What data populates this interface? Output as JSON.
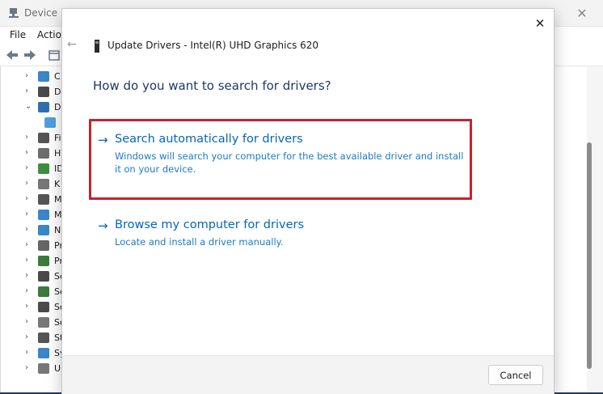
{
  "background_window": {
    "title": "Device M",
    "close_glyph": "✕",
    "menu": [
      "File",
      "Action"
    ],
    "tree_items": [
      {
        "arrow": "›",
        "label": "C",
        "icon": "computer-icon"
      },
      {
        "arrow": "›",
        "label": "D",
        "icon": "disk-drive-icon"
      },
      {
        "arrow": "⌄",
        "label": "D",
        "icon": "display-adapter-icon"
      },
      {
        "arrow": "",
        "label": "",
        "icon": "display-device-icon"
      },
      {
        "arrow": "›",
        "label": "Fi",
        "icon": "firmware-icon"
      },
      {
        "arrow": "›",
        "label": "H",
        "icon": "hid-icon"
      },
      {
        "arrow": "›",
        "label": "ID",
        "icon": "ide-icon"
      },
      {
        "arrow": "›",
        "label": "K",
        "icon": "keyboard-icon"
      },
      {
        "arrow": "›",
        "label": "M",
        "icon": "mouse-icon"
      },
      {
        "arrow": "›",
        "label": "M",
        "icon": "monitor-icon"
      },
      {
        "arrow": "›",
        "label": "N",
        "icon": "network-icon"
      },
      {
        "arrow": "›",
        "label": "Pr",
        "icon": "print-queue-icon"
      },
      {
        "arrow": "›",
        "label": "Pr",
        "icon": "processor-icon"
      },
      {
        "arrow": "›",
        "label": "Se",
        "icon": "security-device-icon"
      },
      {
        "arrow": "›",
        "label": "Se",
        "icon": "sensor-icon"
      },
      {
        "arrow": "›",
        "label": "So",
        "icon": "software-device-icon"
      },
      {
        "arrow": "›",
        "label": "So",
        "icon": "sound-icon"
      },
      {
        "arrow": "›",
        "label": "St",
        "icon": "storage-icon"
      },
      {
        "arrow": "›",
        "label": "Sy",
        "icon": "system-device-icon"
      },
      {
        "arrow": "›",
        "label": "U",
        "icon": "usb-icon"
      }
    ]
  },
  "dialog": {
    "close_glyph": "✕",
    "back_glyph": "←",
    "header_title": "Update Drivers - Intel(R) UHD Graphics 620",
    "question": "How do you want to search for drivers?",
    "options": [
      {
        "arrow": "→",
        "title": "Search automatically for drivers",
        "description": "Windows will search your computer for the best available driver and install it on your device.",
        "highlighted": true
      },
      {
        "arrow": "→",
        "title": "Browse my computer for drivers",
        "description": "Locate and install a driver manually.",
        "highlighted": false
      }
    ],
    "cancel_label": "Cancel"
  },
  "colors": {
    "link_blue": "#0067b8",
    "heading_navy": "#1f3864",
    "highlight_red": "#c8202e"
  }
}
